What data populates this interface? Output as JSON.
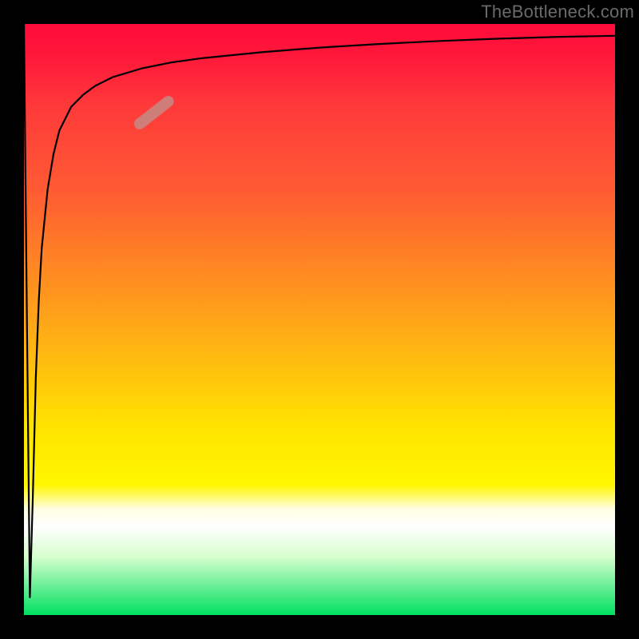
{
  "watermark": "TheBottleneck.com",
  "chart_data": {
    "type": "line",
    "title": "",
    "xlabel": "",
    "ylabel": "",
    "xlim": [
      0,
      100
    ],
    "ylim": [
      0,
      100
    ],
    "grid": false,
    "legend": false,
    "background_gradient": {
      "direction": "vertical",
      "stops": [
        {
          "pos": 0.0,
          "color": "#ff0a3a"
        },
        {
          "pos": 0.42,
          "color": "#ff8a22"
        },
        {
          "pos": 0.68,
          "color": "#ffe300"
        },
        {
          "pos": 0.85,
          "color": "#ffffff"
        },
        {
          "pos": 1.0,
          "color": "#00e060"
        }
      ]
    },
    "series": [
      {
        "name": "curve",
        "x": [
          0,
          0.5,
          1,
          1.5,
          2,
          2.5,
          3,
          4,
          5,
          6,
          8,
          10,
          12,
          15,
          20,
          25,
          30,
          40,
          50,
          60,
          70,
          80,
          90,
          100
        ],
        "y": [
          100,
          50,
          3,
          20,
          40,
          53,
          62,
          72,
          78,
          82,
          86,
          88,
          89.5,
          91,
          92.5,
          93.5,
          94.2,
          95.2,
          96,
          96.6,
          97.1,
          97.5,
          97.8,
          98
        ]
      }
    ],
    "markers": [
      {
        "name": "highlight-segment",
        "x": 22,
        "y": 85,
        "angle_deg": -38,
        "length": 8,
        "color": "#c58a84"
      }
    ]
  }
}
